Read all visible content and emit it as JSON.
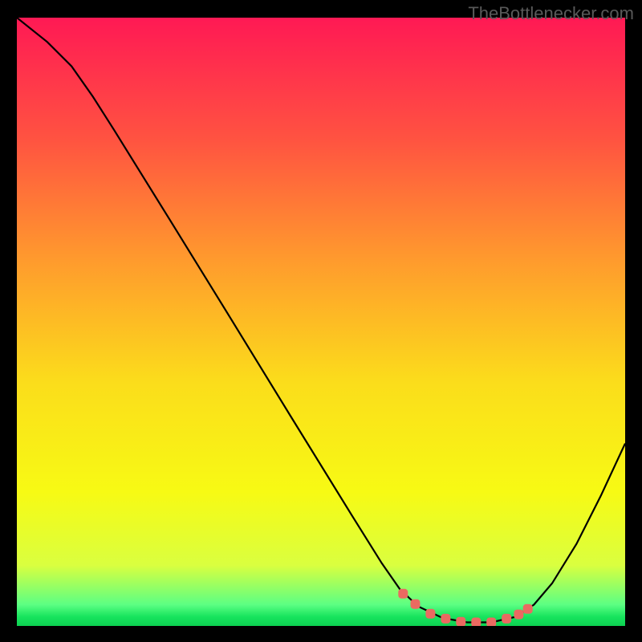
{
  "watermark": "TheBottlenecker.com",
  "chart_data": {
    "type": "line",
    "title": "",
    "xlabel": "",
    "ylabel": "",
    "xlim": [
      0,
      100
    ],
    "ylim": [
      0,
      100
    ],
    "gradient_stops": [
      {
        "offset": 0.0,
        "color": "#ff1954"
      },
      {
        "offset": 0.2,
        "color": "#ff5341"
      },
      {
        "offset": 0.4,
        "color": "#ff9b2d"
      },
      {
        "offset": 0.6,
        "color": "#fbdd1b"
      },
      {
        "offset": 0.78,
        "color": "#f7fa14"
      },
      {
        "offset": 0.9,
        "color": "#daff3f"
      },
      {
        "offset": 0.965,
        "color": "#5cff83"
      },
      {
        "offset": 0.985,
        "color": "#17e35d"
      },
      {
        "offset": 1.0,
        "color": "#0dd151"
      }
    ],
    "series": [
      {
        "name": "bottleneck-curve",
        "color": "#000000",
        "points": [
          {
            "x": 0.0,
            "y": 100.0
          },
          {
            "x": 5.0,
            "y": 96.0
          },
          {
            "x": 9.0,
            "y": 92.0
          },
          {
            "x": 12.5,
            "y": 87.0
          },
          {
            "x": 16.0,
            "y": 81.5
          },
          {
            "x": 25.0,
            "y": 67.0
          },
          {
            "x": 35.0,
            "y": 50.8
          },
          {
            "x": 45.0,
            "y": 34.5
          },
          {
            "x": 55.0,
            "y": 18.3
          },
          {
            "x": 60.0,
            "y": 10.3
          },
          {
            "x": 63.0,
            "y": 6.0
          },
          {
            "x": 66.0,
            "y": 3.2
          },
          {
            "x": 70.0,
            "y": 1.3
          },
          {
            "x": 74.0,
            "y": 0.6
          },
          {
            "x": 78.0,
            "y": 0.6
          },
          {
            "x": 82.0,
            "y": 1.5
          },
          {
            "x": 85.0,
            "y": 3.5
          },
          {
            "x": 88.0,
            "y": 7.0
          },
          {
            "x": 92.0,
            "y": 13.5
          },
          {
            "x": 96.0,
            "y": 21.4
          },
          {
            "x": 100.0,
            "y": 30.0
          }
        ]
      },
      {
        "name": "highlight-markers",
        "color": "#ea6a61",
        "points": [
          {
            "x": 63.5,
            "y": 5.3
          },
          {
            "x": 65.5,
            "y": 3.6
          },
          {
            "x": 68.0,
            "y": 2.0
          },
          {
            "x": 70.5,
            "y": 1.2
          },
          {
            "x": 73.0,
            "y": 0.7
          },
          {
            "x": 75.5,
            "y": 0.6
          },
          {
            "x": 78.0,
            "y": 0.6
          },
          {
            "x": 80.5,
            "y": 1.2
          },
          {
            "x": 82.5,
            "y": 1.9
          },
          {
            "x": 84.0,
            "y": 2.8
          }
        ]
      }
    ]
  }
}
